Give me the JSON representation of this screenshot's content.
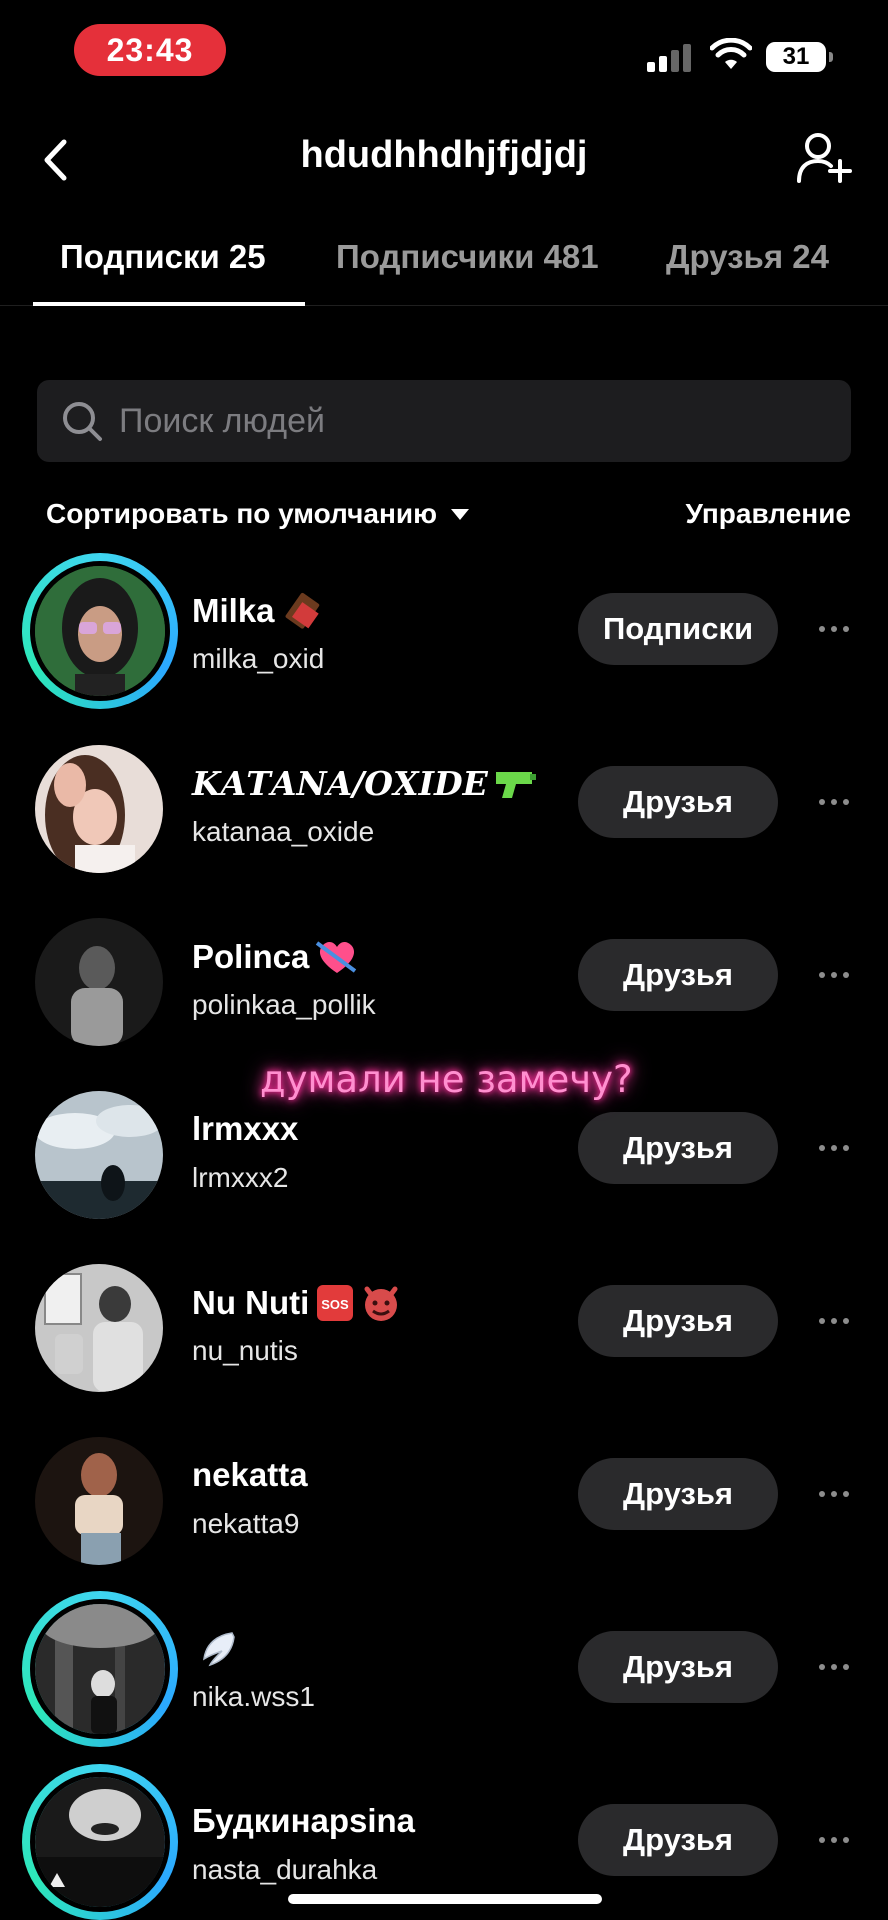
{
  "status_bar": {
    "time": "23:43",
    "battery": "31"
  },
  "header": {
    "title": "hdudhhdhjfjdjdj"
  },
  "tabs": [
    {
      "label": "Подписки 25"
    },
    {
      "label": "Подписчики 481"
    },
    {
      "label": "Друзья 24"
    }
  ],
  "search": {
    "placeholder": "Поиск людей"
  },
  "sort": {
    "label": "Сортировать по умолчанию",
    "manage": "Управление"
  },
  "overlay": {
    "text": "думали не замечу?"
  },
  "users": [
    {
      "name": "Milka",
      "handle": "milka_oxid",
      "button": "Подписки"
    },
    {
      "name": "𝑲𝑨𝑻𝑨𝑵𝑨/𝑶𝑿𝑰𝑫𝑬",
      "handle": "katanaa_oxide",
      "button": "Друзья"
    },
    {
      "name": "Polinca",
      "handle": "polinkaa_pollik",
      "button": "Друзья"
    },
    {
      "name": "lrmxxx",
      "handle": "lrmxxx2",
      "button": "Друзья"
    },
    {
      "name": "Nu Nuti",
      "handle": "nu_nutis",
      "button": "Друзья"
    },
    {
      "name": "nekatta",
      "handle": "nekatta9",
      "button": "Друзья"
    },
    {
      "name": "",
      "handle": "nika.wss1",
      "button": "Друзья"
    },
    {
      "name": "Будкинарsina",
      "handle": "nasta_durahka",
      "button": "Друзья"
    }
  ],
  "icons": {
    "back": "chevron-left-icon",
    "add_user": "add-user-icon",
    "search": "search-icon",
    "more": "more-horizontal-icon"
  },
  "colors": {
    "time_pill": "#e5303a",
    "story_ring": "#2de8b8",
    "button_bg": "#2a2a2c",
    "overlay_text": "#ff8fcf"
  }
}
